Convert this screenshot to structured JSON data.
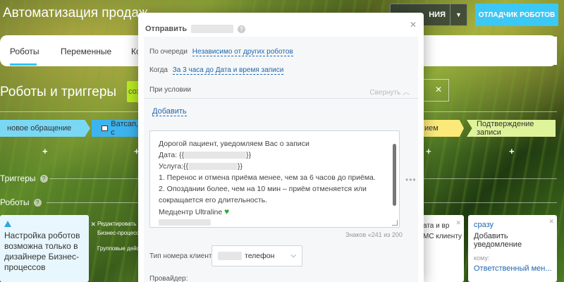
{
  "header": {
    "app_title": "Автоматизация продаж",
    "btn_dark_label": "НИЯ",
    "btn_blue_label": "ОТЛАДЧИК РОБОТОВ"
  },
  "tabs": [
    {
      "label": "Роботы"
    },
    {
      "label": "Переменные"
    },
    {
      "label": "Ко"
    }
  ],
  "section": {
    "title": "Роботы и триггеры",
    "create_label": "соз"
  },
  "stages": {
    "s1": "новое обращение",
    "s2": "Ватсап, с",
    "s3": "ием",
    "s4": "Подтверждение записи"
  },
  "sidebar": {
    "triggers": "Триггеры",
    "robots": "Роботы"
  },
  "cards": {
    "warn_text": "Настройка роботов возможна только в дизайнере Бизнес-процессов",
    "edit_line1": "Редактировать в",
    "edit_line2": "Бизнес-процесс",
    "edit_line3": "Групповые дейс",
    "right1_line1": "ата и вр",
    "right1_line2": "МС клиенту",
    "right2_when": "сразу",
    "right2_title": "Добавить уведомление",
    "right2_to_label": "кому:",
    "right2_to_value": "Ответственный мен..."
  },
  "modal": {
    "title_prefix": "Отправить",
    "queue_label": "По очереди",
    "queue_value": "Независимо от других роботов",
    "when_label": "Когда",
    "when_value": "За 3 часа до Дата и время записи",
    "condition_label": "При условии",
    "collapse_label": "Свернуть",
    "add_label": "Добавить",
    "message_lines": [
      "Дорогой пациент, уведомляем Вас о записи",
      "Дата: {{",
      "Услуга:{{",
      "1. Перенос и отмена приёма менее, чем за 6 часов до приёма.",
      "2. Опоздании более, чем на 10 мин – приём отменяется или",
      "сокращается его длительность.",
      "Медцентр Ultraline"
    ],
    "date_suffix": "}}",
    "service_suffix": "}}",
    "counter": "Знаков «241 из 200",
    "phone_label": "Тип номера клиента:",
    "phone_value": "телефон",
    "provider_label": "Провайдер:"
  }
}
